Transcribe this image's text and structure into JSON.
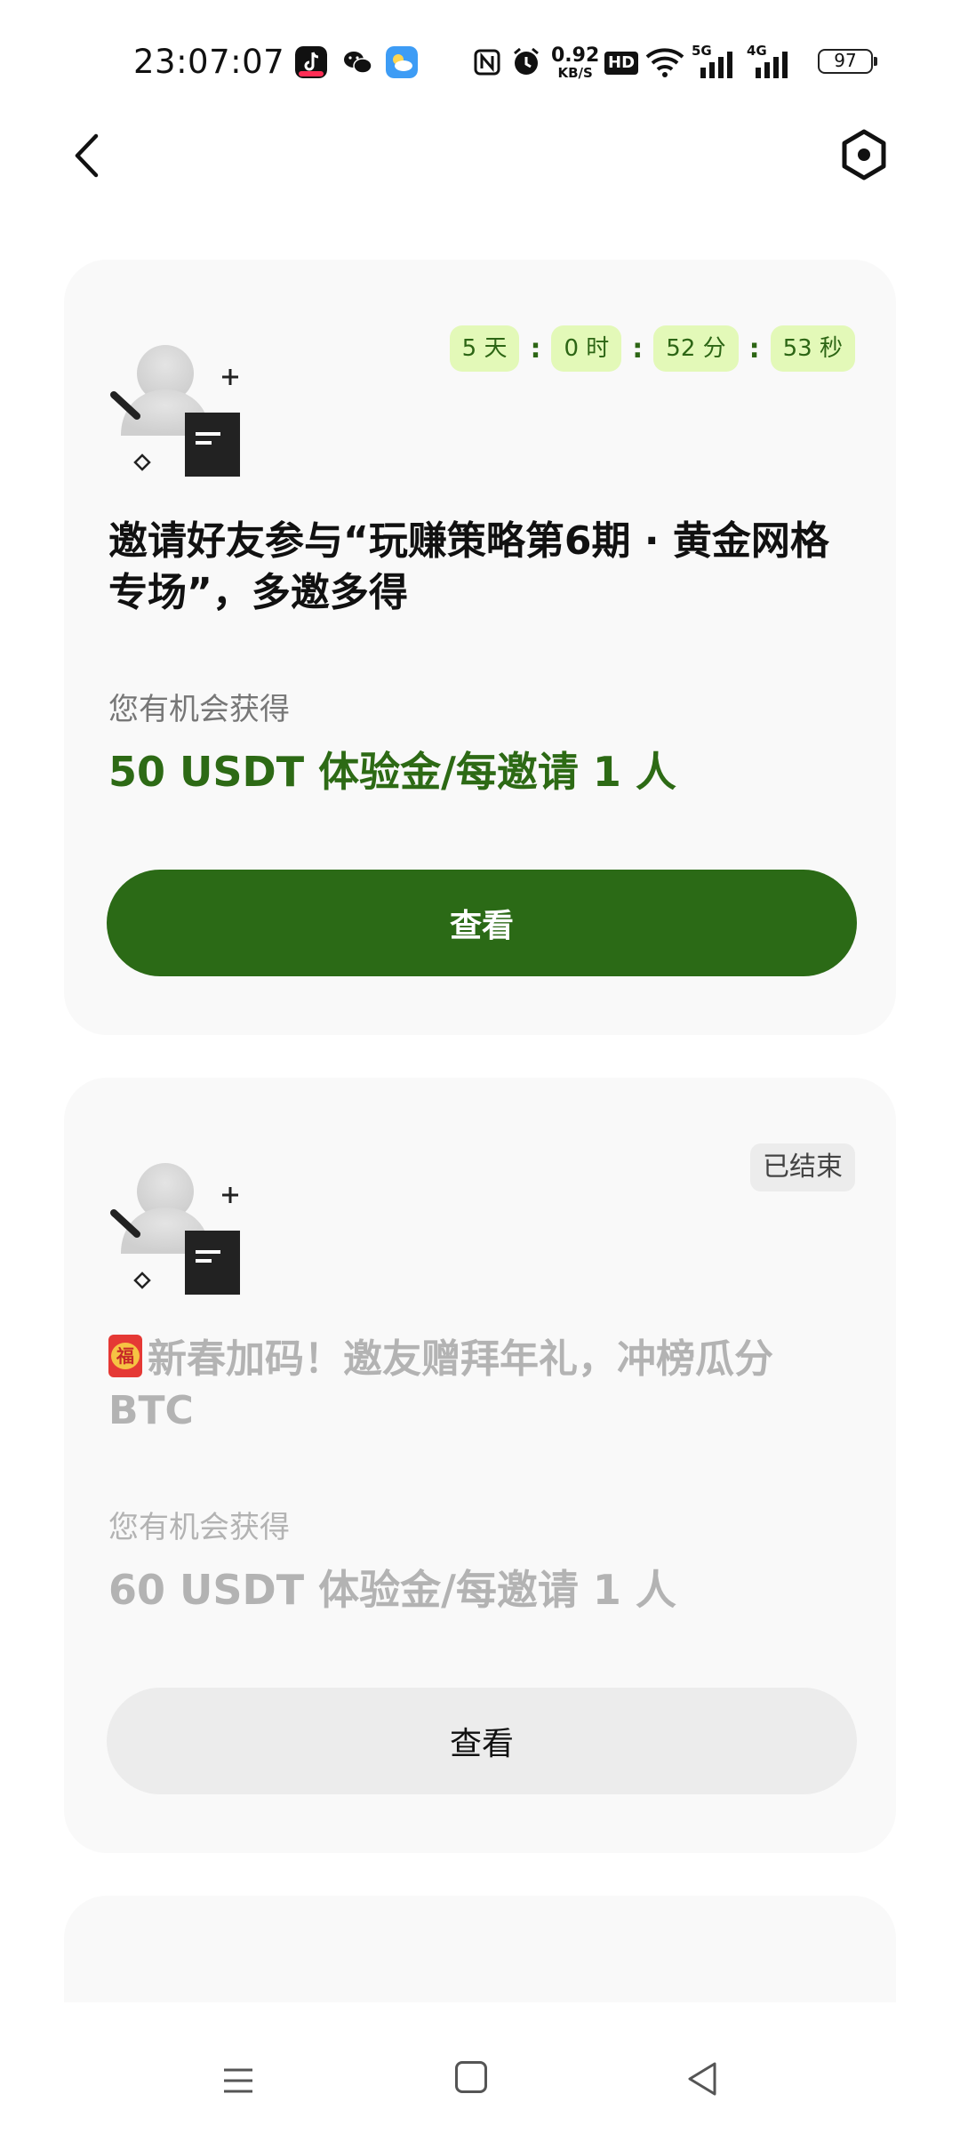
{
  "status_bar": {
    "time": "23:07:07",
    "net_speed_value": "0.92",
    "net_speed_unit": "KB/S",
    "hd_label": "HD",
    "sim1_label": "5G",
    "sim2_label": "4G",
    "battery": "97"
  },
  "nav": {
    "back_icon": "chevron-left-icon",
    "settings_icon": "hexagon-settings-icon"
  },
  "cards": [
    {
      "countdown": {
        "days": "5 天",
        "hours": "0 时",
        "minutes": "52 分",
        "seconds": "53 秒",
        "separator": ":"
      },
      "title": "邀请好友参与“玩赚策略第6期 · 黄金网格专场”，多邀多得",
      "reward_label": "您有机会获得",
      "reward_value": "50 USDT 体验金/每邀请 1 人",
      "button_label": "查看",
      "accent_color": "#2b6a16"
    },
    {
      "status": "已结束",
      "title": "新春加码！邀友赠拜年礼，冲榜瓜分BTC",
      "title_icon": "red-envelope-icon",
      "reward_label": "您有机会获得",
      "reward_value": "60 USDT 体验金/每邀请 1 人",
      "button_label": "查看"
    }
  ],
  "system_nav": {
    "menu_icon": "menu-icon",
    "home_icon": "home-square-icon",
    "back_icon": "triangle-back-icon"
  }
}
